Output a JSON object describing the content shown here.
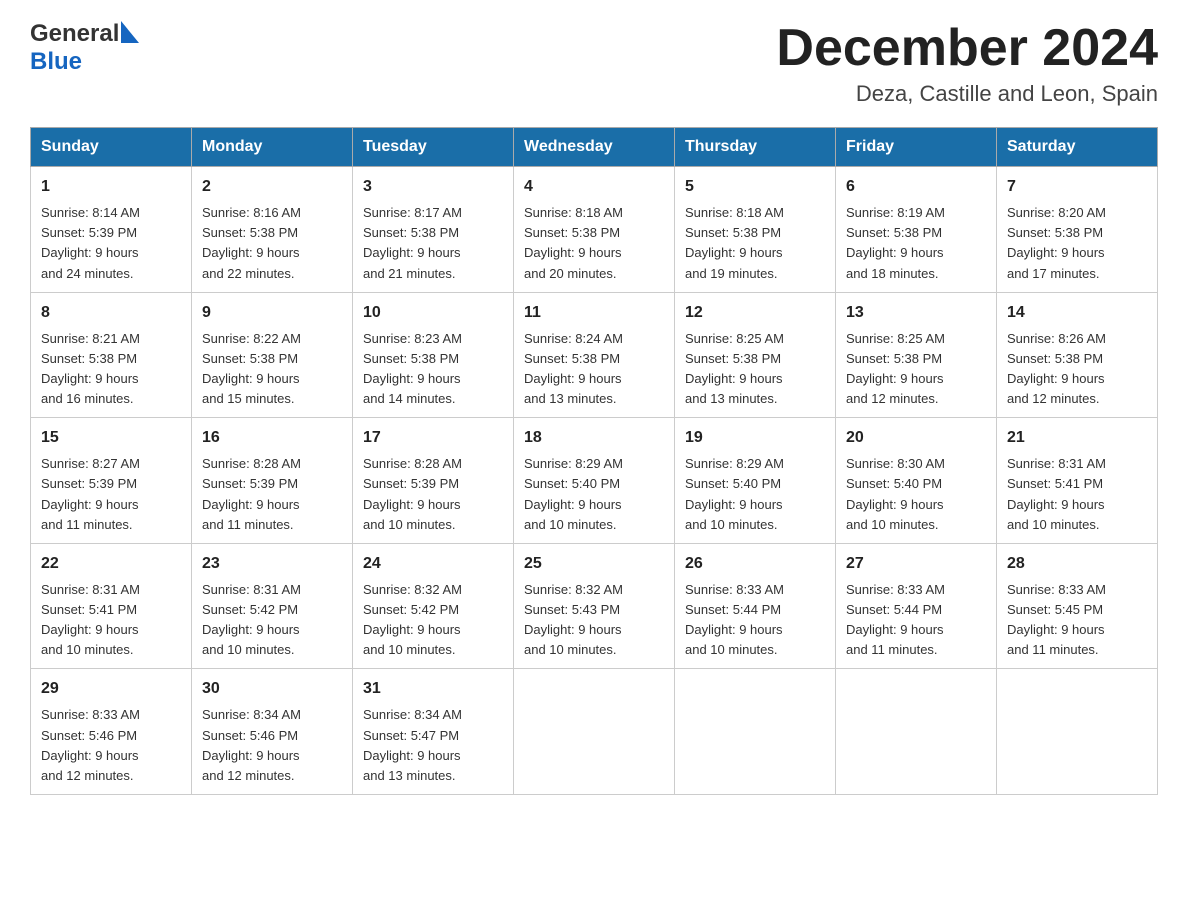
{
  "header": {
    "logo_general": "General",
    "logo_blue": "Blue",
    "month_year": "December 2024",
    "location": "Deza, Castille and Leon, Spain"
  },
  "days_of_week": [
    "Sunday",
    "Monday",
    "Tuesday",
    "Wednesday",
    "Thursday",
    "Friday",
    "Saturday"
  ],
  "weeks": [
    [
      {
        "day": "1",
        "sunrise": "8:14 AM",
        "sunset": "5:39 PM",
        "daylight": "9 hours and 24 minutes."
      },
      {
        "day": "2",
        "sunrise": "8:16 AM",
        "sunset": "5:38 PM",
        "daylight": "9 hours and 22 minutes."
      },
      {
        "day": "3",
        "sunrise": "8:17 AM",
        "sunset": "5:38 PM",
        "daylight": "9 hours and 21 minutes."
      },
      {
        "day": "4",
        "sunrise": "8:18 AM",
        "sunset": "5:38 PM",
        "daylight": "9 hours and 20 minutes."
      },
      {
        "day": "5",
        "sunrise": "8:18 AM",
        "sunset": "5:38 PM",
        "daylight": "9 hours and 19 minutes."
      },
      {
        "day": "6",
        "sunrise": "8:19 AM",
        "sunset": "5:38 PM",
        "daylight": "9 hours and 18 minutes."
      },
      {
        "day": "7",
        "sunrise": "8:20 AM",
        "sunset": "5:38 PM",
        "daylight": "9 hours and 17 minutes."
      }
    ],
    [
      {
        "day": "8",
        "sunrise": "8:21 AM",
        "sunset": "5:38 PM",
        "daylight": "9 hours and 16 minutes."
      },
      {
        "day": "9",
        "sunrise": "8:22 AM",
        "sunset": "5:38 PM",
        "daylight": "9 hours and 15 minutes."
      },
      {
        "day": "10",
        "sunrise": "8:23 AM",
        "sunset": "5:38 PM",
        "daylight": "9 hours and 14 minutes."
      },
      {
        "day": "11",
        "sunrise": "8:24 AM",
        "sunset": "5:38 PM",
        "daylight": "9 hours and 13 minutes."
      },
      {
        "day": "12",
        "sunrise": "8:25 AM",
        "sunset": "5:38 PM",
        "daylight": "9 hours and 13 minutes."
      },
      {
        "day": "13",
        "sunrise": "8:25 AM",
        "sunset": "5:38 PM",
        "daylight": "9 hours and 12 minutes."
      },
      {
        "day": "14",
        "sunrise": "8:26 AM",
        "sunset": "5:38 PM",
        "daylight": "9 hours and 12 minutes."
      }
    ],
    [
      {
        "day": "15",
        "sunrise": "8:27 AM",
        "sunset": "5:39 PM",
        "daylight": "9 hours and 11 minutes."
      },
      {
        "day": "16",
        "sunrise": "8:28 AM",
        "sunset": "5:39 PM",
        "daylight": "9 hours and 11 minutes."
      },
      {
        "day": "17",
        "sunrise": "8:28 AM",
        "sunset": "5:39 PM",
        "daylight": "9 hours and 10 minutes."
      },
      {
        "day": "18",
        "sunrise": "8:29 AM",
        "sunset": "5:40 PM",
        "daylight": "9 hours and 10 minutes."
      },
      {
        "day": "19",
        "sunrise": "8:29 AM",
        "sunset": "5:40 PM",
        "daylight": "9 hours and 10 minutes."
      },
      {
        "day": "20",
        "sunrise": "8:30 AM",
        "sunset": "5:40 PM",
        "daylight": "9 hours and 10 minutes."
      },
      {
        "day": "21",
        "sunrise": "8:31 AM",
        "sunset": "5:41 PM",
        "daylight": "9 hours and 10 minutes."
      }
    ],
    [
      {
        "day": "22",
        "sunrise": "8:31 AM",
        "sunset": "5:41 PM",
        "daylight": "9 hours and 10 minutes."
      },
      {
        "day": "23",
        "sunrise": "8:31 AM",
        "sunset": "5:42 PM",
        "daylight": "9 hours and 10 minutes."
      },
      {
        "day": "24",
        "sunrise": "8:32 AM",
        "sunset": "5:42 PM",
        "daylight": "9 hours and 10 minutes."
      },
      {
        "day": "25",
        "sunrise": "8:32 AM",
        "sunset": "5:43 PM",
        "daylight": "9 hours and 10 minutes."
      },
      {
        "day": "26",
        "sunrise": "8:33 AM",
        "sunset": "5:44 PM",
        "daylight": "9 hours and 10 minutes."
      },
      {
        "day": "27",
        "sunrise": "8:33 AM",
        "sunset": "5:44 PM",
        "daylight": "9 hours and 11 minutes."
      },
      {
        "day": "28",
        "sunrise": "8:33 AM",
        "sunset": "5:45 PM",
        "daylight": "9 hours and 11 minutes."
      }
    ],
    [
      {
        "day": "29",
        "sunrise": "8:33 AM",
        "sunset": "5:46 PM",
        "daylight": "9 hours and 12 minutes."
      },
      {
        "day": "30",
        "sunrise": "8:34 AM",
        "sunset": "5:46 PM",
        "daylight": "9 hours and 12 minutes."
      },
      {
        "day": "31",
        "sunrise": "8:34 AM",
        "sunset": "5:47 PM",
        "daylight": "9 hours and 13 minutes."
      },
      null,
      null,
      null,
      null
    ]
  ],
  "labels": {
    "sunrise": "Sunrise:",
    "sunset": "Sunset:",
    "daylight": "Daylight:"
  }
}
